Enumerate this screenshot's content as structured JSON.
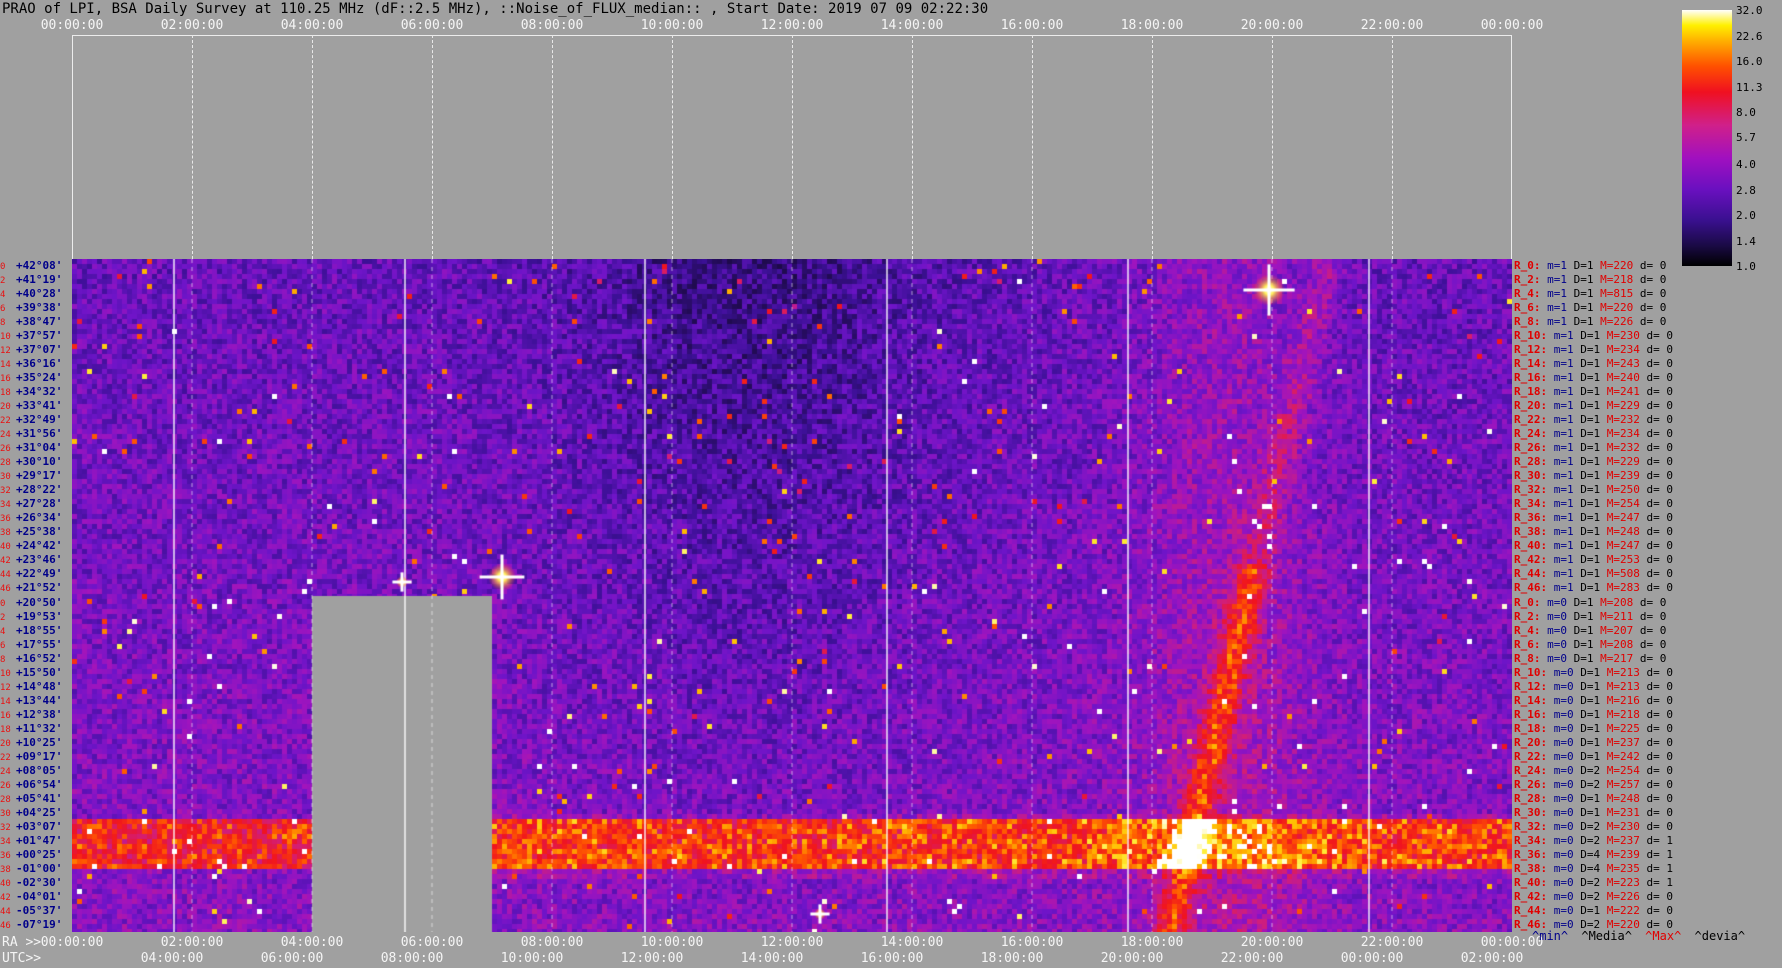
{
  "title": "PRAO of LPI, BSA Daily Survey at 110.25 MHz (dF::2.5 MHz), ::Noise_of_FLUX_median:: , Start Date: 2019 07 09 02:22:30",
  "top_axis": [
    "00:00:00",
    "02:00:00",
    "04:00:00",
    "06:00:00",
    "08:00:00",
    "10:00:00",
    "12:00:00",
    "14:00:00",
    "16:00:00",
    "18:00:00",
    "20:00:00",
    "22:00:00",
    "00:00:00"
  ],
  "ra_prefix": "RA >>",
  "ra_axis": [
    "00:00:00",
    "02:00:00",
    "04:00:00",
    "06:00:00",
    "08:00:00",
    "10:00:00",
    "12:00:00",
    "14:00:00",
    "16:00:00",
    "18:00:00",
    "20:00:00",
    "22:00:00",
    "00:00:00"
  ],
  "utc_prefix": "UTC>>",
  "utc_axis": [
    "04:00:00",
    "06:00:00",
    "08:00:00",
    "10:00:00",
    "12:00:00",
    "14:00:00",
    "16:00:00",
    "18:00:00",
    "20:00:00",
    "22:00:00",
    "00:00:00",
    "02:00:00"
  ],
  "colorbar": {
    "ticks": [
      "32.0",
      "22.6",
      "16.0",
      "11.3",
      "8.0",
      "5.7",
      "4.0",
      "2.8",
      "2.0",
      "1.4",
      "1.0"
    ]
  },
  "legend": {
    "min": "^min^",
    "media": "^Media^",
    "max": "^Max^",
    "dev": "^devia^"
  },
  "colors": {
    "background": "#a0a0a0",
    "stat_name": "#e00000",
    "dec_label": "#00008a"
  },
  "chart_data": {
    "type": "heatmap",
    "title": "PRAO of LPI, BSA Daily Survey at 110.25 MHz (dF::2.5 MHz), ::Noise_of_FLUX_median:: , Start Date: 2019 07 09 02:22:30",
    "x_axis": "RA / UTC time",
    "y_axis": "Declination",
    "declinations": [
      "+42°08'",
      "+41°19'",
      "+40°28'",
      "+39°38'",
      "+38°47'",
      "+37°57'",
      "+37°07'",
      "+36°16'",
      "+35°24'",
      "+34°32'",
      "+33°41'",
      "+32°49'",
      "+31°56'",
      "+31°04'",
      "+30°10'",
      "+29°17'",
      "+28°22'",
      "+27°28'",
      "+26°34'",
      "+25°38'",
      "+24°42'",
      "+23°46'",
      "+22°49'",
      "+21°52'",
      "+20°50'",
      "+19°53'",
      "+18°55'",
      "+17°55'",
      "+16°52'",
      "+15°50'",
      "+14°48'",
      "+13°44'",
      "+12°38'",
      "+11°32'",
      "+10°25'",
      "+09°17'",
      "+08°05'",
      "+06°54'",
      "+05°41'",
      "+04°25'",
      "+03°07'",
      "+01°47'",
      "+00°25'",
      "-01°00'",
      "-02°30'",
      "-04°01'",
      "-05°37'",
      "-07°19'"
    ],
    "row_indices": [
      "0",
      "2",
      "4",
      "6",
      "8",
      "10",
      "12",
      "14",
      "16",
      "18",
      "20",
      "22",
      "24",
      "26",
      "28",
      "30",
      "32",
      "34",
      "36",
      "38",
      "40",
      "42",
      "44",
      "46",
      "0",
      "2",
      "4",
      "6",
      "8",
      "10",
      "12",
      "14",
      "16",
      "18",
      "20",
      "22",
      "24",
      "26",
      "28",
      "30",
      "32",
      "34",
      "36",
      "38",
      "40",
      "42",
      "44",
      "46"
    ],
    "colorbar_range": [
      1.0,
      32.0
    ],
    "colorbar_scale": "log",
    "row_stats": [
      {
        "name": "R_0:",
        "m": "m=1",
        "D": "D=1",
        "M": "M=220",
        "d": "d= 0"
      },
      {
        "name": "R_2:",
        "m": "m=1",
        "D": "D=1",
        "M": "M=218",
        "d": "d= 0"
      },
      {
        "name": "R_4:",
        "m": "m=1",
        "D": "D=1",
        "M": "M=815",
        "d": "d= 0"
      },
      {
        "name": "R_6:",
        "m": "m=1",
        "D": "D=1",
        "M": "M=220",
        "d": "d= 0"
      },
      {
        "name": "R_8:",
        "m": "m=1",
        "D": "D=1",
        "M": "M=226",
        "d": "d= 0"
      },
      {
        "name": "R_10:",
        "m": "m=1",
        "D": "D=1",
        "M": "M=230",
        "d": "d= 0"
      },
      {
        "name": "R_12:",
        "m": "m=1",
        "D": "D=1",
        "M": "M=234",
        "d": "d= 0"
      },
      {
        "name": "R_14:",
        "m": "m=1",
        "D": "D=1",
        "M": "M=243",
        "d": "d= 0"
      },
      {
        "name": "R_16:",
        "m": "m=1",
        "D": "D=1",
        "M": "M=240",
        "d": "d= 0"
      },
      {
        "name": "R_18:",
        "m": "m=1",
        "D": "D=1",
        "M": "M=241",
        "d": "d= 0"
      },
      {
        "name": "R_20:",
        "m": "m=1",
        "D": "D=1",
        "M": "M=229",
        "d": "d= 0"
      },
      {
        "name": "R_22:",
        "m": "m=1",
        "D": "D=1",
        "M": "M=232",
        "d": "d= 0"
      },
      {
        "name": "R_24:",
        "m": "m=1",
        "D": "D=1",
        "M": "M=234",
        "d": "d= 0"
      },
      {
        "name": "R_26:",
        "m": "m=1",
        "D": "D=1",
        "M": "M=232",
        "d": "d= 0"
      },
      {
        "name": "R_28:",
        "m": "m=1",
        "D": "D=1",
        "M": "M=229",
        "d": "d= 0"
      },
      {
        "name": "R_30:",
        "m": "m=1",
        "D": "D=1",
        "M": "M=239",
        "d": "d= 0"
      },
      {
        "name": "R_32:",
        "m": "m=1",
        "D": "D=1",
        "M": "M=250",
        "d": "d= 0"
      },
      {
        "name": "R_34:",
        "m": "m=1",
        "D": "D=1",
        "M": "M=254",
        "d": "d= 0"
      },
      {
        "name": "R_36:",
        "m": "m=1",
        "D": "D=1",
        "M": "M=247",
        "d": "d= 0"
      },
      {
        "name": "R_38:",
        "m": "m=1",
        "D": "D=1",
        "M": "M=248",
        "d": "d= 0"
      },
      {
        "name": "R_40:",
        "m": "m=1",
        "D": "D=1",
        "M": "M=247",
        "d": "d= 0"
      },
      {
        "name": "R_42:",
        "m": "m=1",
        "D": "D=1",
        "M": "M=253",
        "d": "d= 0"
      },
      {
        "name": "R_44:",
        "m": "m=1",
        "D": "D=1",
        "M": "M=508",
        "d": "d= 0"
      },
      {
        "name": "R_46:",
        "m": "m=1",
        "D": "D=1",
        "M": "M=283",
        "d": "d= 0"
      },
      {
        "name": "R_0:",
        "m": "m=0",
        "D": "D=1",
        "M": "M=208",
        "d": "d= 0"
      },
      {
        "name": "R_2:",
        "m": "m=0",
        "D": "D=1",
        "M": "M=211",
        "d": "d= 0"
      },
      {
        "name": "R_4:",
        "m": "m=0",
        "D": "D=1",
        "M": "M=207",
        "d": "d= 0"
      },
      {
        "name": "R_6:",
        "m": "m=0",
        "D": "D=1",
        "M": "M=208",
        "d": "d= 0"
      },
      {
        "name": "R_8:",
        "m": "m=0",
        "D": "D=1",
        "M": "M=217",
        "d": "d= 0"
      },
      {
        "name": "R_10:",
        "m": "m=0",
        "D": "D=1",
        "M": "M=213",
        "d": "d= 0"
      },
      {
        "name": "R_12:",
        "m": "m=0",
        "D": "D=1",
        "M": "M=213",
        "d": "d= 0"
      },
      {
        "name": "R_14:",
        "m": "m=0",
        "D": "D=1",
        "M": "M=216",
        "d": "d= 0"
      },
      {
        "name": "R_16:",
        "m": "m=0",
        "D": "D=1",
        "M": "M=218",
        "d": "d= 0"
      },
      {
        "name": "R_18:",
        "m": "m=0",
        "D": "D=1",
        "M": "M=225",
        "d": "d= 0"
      },
      {
        "name": "R_20:",
        "m": "m=0",
        "D": "D=1",
        "M": "M=237",
        "d": "d= 0"
      },
      {
        "name": "R_22:",
        "m": "m=0",
        "D": "D=1",
        "M": "M=242",
        "d": "d= 0"
      },
      {
        "name": "R_24:",
        "m": "m=0",
        "D": "D=2",
        "M": "M=254",
        "d": "d= 0"
      },
      {
        "name": "R_26:",
        "m": "m=0",
        "D": "D=2",
        "M": "M=257",
        "d": "d= 0"
      },
      {
        "name": "R_28:",
        "m": "m=0",
        "D": "D=1",
        "M": "M=248",
        "d": "d= 0"
      },
      {
        "name": "R_30:",
        "m": "m=0",
        "D": "D=1",
        "M": "M=231",
        "d": "d= 0"
      },
      {
        "name": "R_32:",
        "m": "m=0",
        "D": "D=2",
        "M": "M=230",
        "d": "d= 0"
      },
      {
        "name": "R_34:",
        "m": "m=0",
        "D": "D=2",
        "M": "M=237",
        "d": "d= 1"
      },
      {
        "name": "R_36:",
        "m": "m=0",
        "D": "D=4",
        "M": "M=239",
        "d": "d= 1"
      },
      {
        "name": "R_38:",
        "m": "m=0",
        "D": "D=4",
        "M": "M=235",
        "d": "d= 1"
      },
      {
        "name": "R_40:",
        "m": "m=0",
        "D": "D=2",
        "M": "M=223",
        "d": "d= 1"
      },
      {
        "name": "R_42:",
        "m": "m=0",
        "D": "D=2",
        "M": "M=226",
        "d": "d= 0"
      },
      {
        "name": "R_44:",
        "m": "m=0",
        "D": "D=1",
        "M": "M=222",
        "d": "d= 0"
      },
      {
        "name": "R_46:",
        "m": "m=0",
        "D": "D=2",
        "M": "M=220",
        "d": "d= 0"
      }
    ]
  }
}
